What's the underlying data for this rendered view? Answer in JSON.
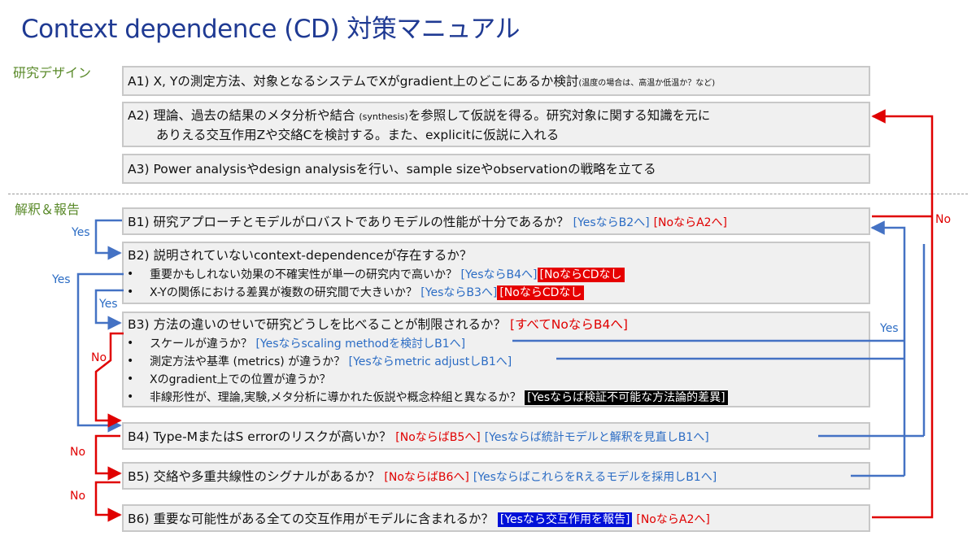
{
  "title": "Context dependence (CD) 対策マニュアル",
  "sections": {
    "design": "研究デザイン",
    "report": "解釈＆報告"
  },
  "A1": {
    "text": "A1) X, Yの測定方法、対象となるシステムでXがgradient上のどこにあるか検討",
    "note": "(温度の場合は、高温か低温か？など)"
  },
  "A2": {
    "line1_pre": "A2) 理論、過去の結果のメタ分析や結合 ",
    "line1_sub": "(synthesis)",
    "line1_post": "を参照して仮説を得る。研究対象に関する知識を元に",
    "line2": "ありえる交互作用Zや交絡Cを検討する。また、explicitに仮説に入れる"
  },
  "A3": {
    "text": "A3) Power analysisやdesign analysisを行い、sample sizeやobservationの戦略を立てる"
  },
  "B1": {
    "text": "B1) 研究アプローチとモデルがロバストでありモデルの性能が十分であるか？ ",
    "yes": "[YesならB2へ]",
    "no": "[NoならA2へ]"
  },
  "B2": {
    "text": "B2) 説明されていないcontext-dependenceが存在するか？",
    "bullets": [
      {
        "text": "重要かもしれない効果の不確実性が単一の研究内で高いか？ ",
        "yes": "[YesならB4へ]",
        "no": "[NoならCDなし"
      },
      {
        "text": "X-Yの関係における差異が複数の研究間で大きいか？ ",
        "yes": "[YesならB3へ]",
        "no": "[NoならCDなし"
      }
    ]
  },
  "B3": {
    "text": "B3) 方法の違いのせいで研究どうしを比べることが制限されるか？ ",
    "all_no": "[すべてNoならB4へ]",
    "bullets": [
      {
        "text": "スケールが違うか？ ",
        "yes": "[Yesならscaling methodを検討しB1へ]"
      },
      {
        "text": "測定方法や基準 (metrics) が違うか？ ",
        "yes": "[Yesならmetric adjustしB1へ]"
      },
      {
        "text": "Xのgradient上での位置が違うか？"
      },
      {
        "text": "非線形性が、理論,実験,メタ分析に導かれた仮説や概念枠組と異なるか？ ",
        "tag": "[Yesならば検証不可能な方法論的差異]"
      }
    ]
  },
  "B4": {
    "text": "B4) Type-MまたはS errorのリスクが高いか？ ",
    "no": "[NoならばB5へ]",
    "yes": "[Yesならば統計モデルと解釈を見直しB1へ]"
  },
  "B5": {
    "text": "B5) 交絡や多重共線性のシグナルがあるか？ ",
    "no": "[NoならばB6へ]",
    "yes": "[YesならばこれらをRえるモデルを採用しB1へ]"
  },
  "B6": {
    "text": "B6) 重要な可能性がある全ての交互作用がモデルに含まれるか？ ",
    "yes": "[Yesなら交互作用を報告]",
    "no": "[NoならA2へ]"
  },
  "flow_labels": {
    "yes_b1_b2": "Yes",
    "yes_b2_b4": "Yes",
    "yes_b2_b3": "Yes",
    "no_b3_b4": "No",
    "no_b4_b5": "No",
    "no_b5_b6": "No",
    "no_right": "No",
    "yes_right": "Yes"
  },
  "colors": {
    "yes": "#4472c4",
    "no": "#e00000",
    "title": "#1f3a93",
    "section": "#5a8a2a"
  }
}
